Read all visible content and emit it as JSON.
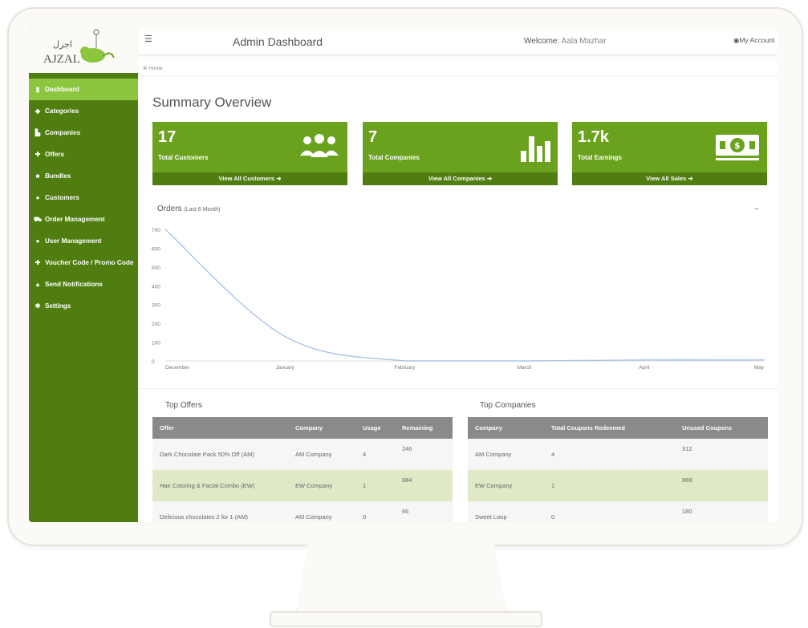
{
  "header": {
    "title": "Admin Dashboard",
    "welcome_label": "Welcome:",
    "user_name": "Aala Mazhar",
    "account_label": "My Account",
    "menu_icon": "hamburger-icon"
  },
  "logo": {
    "text": "AJZAL",
    "arabic": "اجزل"
  },
  "breadcrumb": {
    "home": "Home"
  },
  "sidebar": {
    "items": [
      {
        "label": "Dashboard",
        "icon": "bar-chart-icon",
        "active": true
      },
      {
        "label": "Categories",
        "icon": "tag-icon"
      },
      {
        "label": "Companies",
        "icon": "building-icon"
      },
      {
        "label": "Offers",
        "icon": "gift-icon"
      },
      {
        "label": "Bundles",
        "icon": "briefcase-icon"
      },
      {
        "label": "Customers",
        "icon": "users-icon"
      },
      {
        "label": "Order Management",
        "icon": "cart-icon"
      },
      {
        "label": "User Management",
        "icon": "users-icon"
      },
      {
        "label": "Voucher Code / Promo Code",
        "icon": "gift-icon"
      },
      {
        "label": "Send Notifications",
        "icon": "bell-icon"
      },
      {
        "label": "Settings",
        "icon": "gear-icon"
      }
    ]
  },
  "summary": {
    "title": "Summary Overview"
  },
  "cards": [
    {
      "value": "17",
      "label": "Total Customers",
      "link": "View All Customers",
      "icon": "people-icon"
    },
    {
      "value": "7",
      "label": "Total Companies",
      "link": "View All Companies",
      "icon": "bar-chart-icon"
    },
    {
      "value": "1.7k",
      "label": "Total Earnings",
      "link": "View All Sales",
      "icon": "money-icon"
    }
  ],
  "orders": {
    "title": "Orders",
    "subtitle": "(Last 6 Month)",
    "collapse": "–"
  },
  "chart_data": {
    "type": "line",
    "x": [
      "December",
      "January",
      "February",
      "March",
      "April",
      "May"
    ],
    "series": [
      {
        "values": [
          700,
          130,
          0,
          0,
          5,
          5
        ]
      }
    ],
    "ylim": [
      0,
      700
    ],
    "yticks": [
      0,
      100,
      200,
      300,
      400,
      500,
      600,
      700
    ],
    "grid": false,
    "color": "#a9c5e3"
  },
  "top_offers": {
    "title": "Top Offers",
    "columns": [
      "Offer",
      "Company",
      "Usage",
      "Remaining"
    ],
    "rows": [
      [
        "Dark Chocolate Pack 50% Off (AM)",
        "AM Company",
        "4",
        "246"
      ],
      [
        "Hair Coloring & Facial Combo (EW)",
        "EW Company",
        "1",
        "684"
      ],
      [
        "Delicious chocolates 2 for 1 (AM)",
        "AM Company",
        "0",
        "66"
      ]
    ]
  },
  "top_companies": {
    "title": "Top Companies",
    "columns": [
      "Company",
      "Total Coupons Redeemed",
      "Unused Coupons"
    ],
    "rows": [
      [
        "AM Company",
        "4",
        "312"
      ],
      [
        "EW Company",
        "1",
        "869"
      ],
      [
        "Sweet Loop",
        "0",
        "180"
      ]
    ]
  },
  "colors": {
    "primary": "#4f7d10",
    "accent": "#6aa21e",
    "active": "#8cc63f",
    "table_header": "#8a8a8a"
  }
}
